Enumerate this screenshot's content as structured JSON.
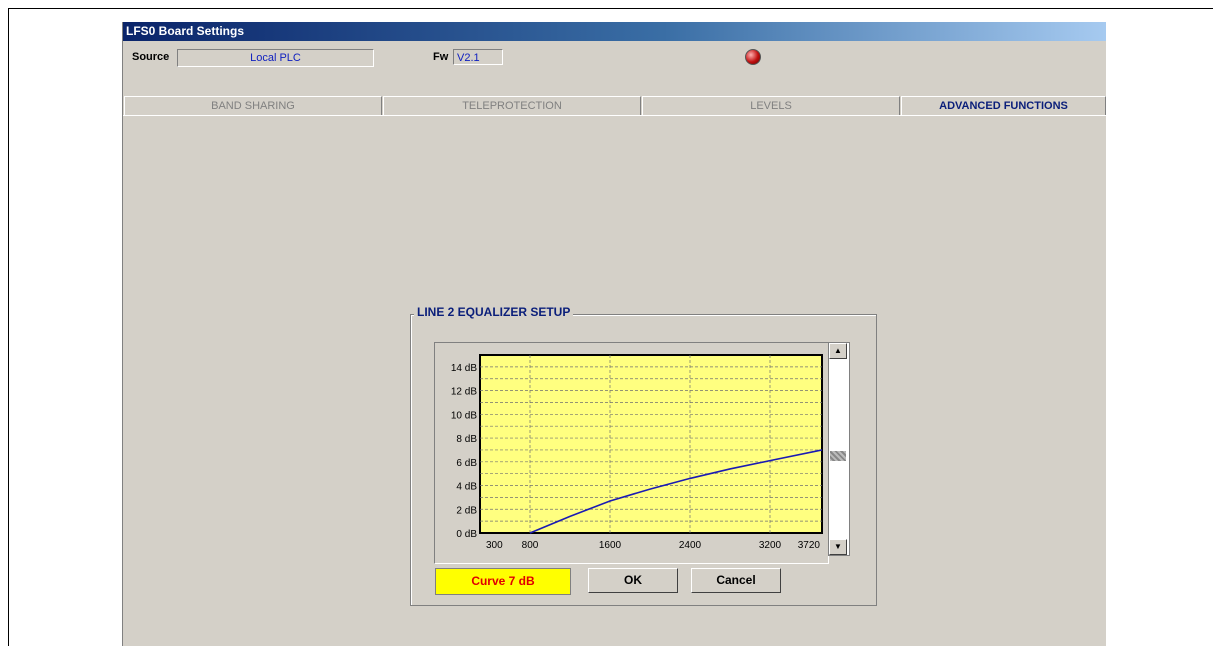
{
  "window": {
    "title": "LFS0 Board Settings"
  },
  "source": {
    "label": "Source",
    "value": "Local PLC"
  },
  "firmware": {
    "label": "Fw",
    "value": "V2.1"
  },
  "status_led": {
    "color": "#c01010"
  },
  "tabs": [
    {
      "label": "BAND SHARING",
      "active": false
    },
    {
      "label": "TELEPROTECTION",
      "active": false
    },
    {
      "label": "LEVELS",
      "active": false
    },
    {
      "label": "ADVANCED FUNCTIONS",
      "active": true
    }
  ],
  "equalizer": {
    "title": "LINE 2 EQUALIZER SETUP",
    "curve_label": "Curve 7 dB",
    "ok_label": "OK",
    "cancel_label": "Cancel"
  },
  "chart_data": {
    "type": "line",
    "title": "",
    "xlabel": "",
    "ylabel": "",
    "x_ticks": [
      "300",
      "800",
      "1600",
      "2400",
      "3200",
      "3720"
    ],
    "y_ticks": [
      "0 dB",
      "2 dB",
      "4 dB",
      "6 dB",
      "8 dB",
      "10 dB",
      "12 dB",
      "14 dB"
    ],
    "xlim": [
      300,
      3720
    ],
    "ylim": [
      0,
      15
    ],
    "grid": true,
    "background": "#ffff80",
    "line_color": "#1a1ab4",
    "series": [
      {
        "x": [
          800,
          1200,
          1600,
          2000,
          2400,
          2800,
          3200,
          3720
        ],
        "values": [
          0,
          1.4,
          2.7,
          3.7,
          4.6,
          5.4,
          6.1,
          7.0
        ]
      }
    ]
  }
}
